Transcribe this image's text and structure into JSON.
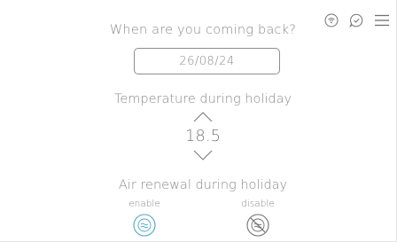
{
  "header": {
    "question": "When are you coming back?",
    "icons": [
      "wifi-icon",
      "check-icon",
      "menu-icon"
    ]
  },
  "date_field": {
    "value": "26/08/24"
  },
  "temperature": {
    "label": "Temperature during holiday",
    "value": "18.5",
    "up_icon": "chevron-up-icon",
    "down_icon": "chevron-down-icon"
  },
  "air_renewal": {
    "label": "Air renewal during holiday",
    "enable_label": "enable",
    "disable_label": "disable",
    "selected": "enable",
    "enable_icon": "fan-icon",
    "disable_icon": "fan-off-icon"
  },
  "colors": {
    "text": "#8a8a8a",
    "accent": "#4ba8c8",
    "border": "#8e8e8e",
    "icon_gray": "#6f6f6f"
  }
}
